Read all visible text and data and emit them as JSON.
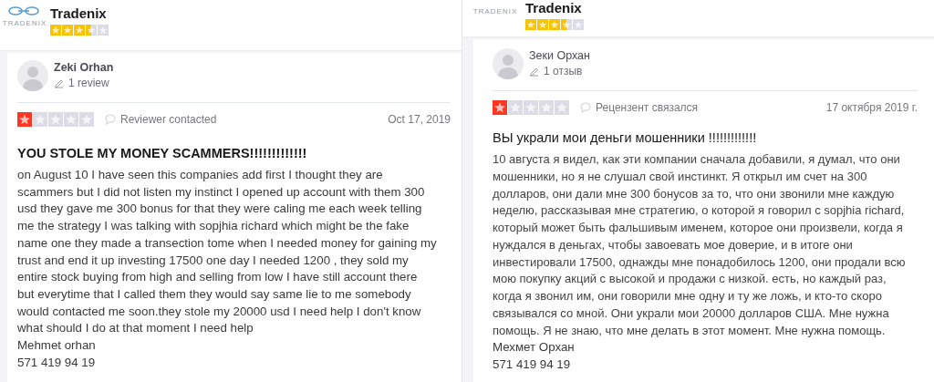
{
  "panels": [
    {
      "kind": "full",
      "company": {
        "logo_text": "TRADENIX",
        "name": "Tradenix",
        "stars": 3.5
      },
      "review": {
        "reviewer": "Zeki Orhan",
        "review_count": "1 review",
        "stars": 1,
        "status": "Reviewer contacted",
        "date": "Oct 17, 2019",
        "title": "YOU STOLE MY MONEY SCAMMERS!!!!!!!!!!!!!",
        "body": "on August 10 I have seen this companies add first I thought they are\nscammers but I did not listen my instinct I opened up account with them 300\nusd they gave me 300 bonus for that they were caling me each week telling\nme the strategy I was talking with sopjhia richard which might be the fake\nname one they made a transection tome when I needed money for gaining my\ntrust and end it up investing 17500 one day I needed 1200 , they sold my\nentire stock buying from high and selling from low I have still account there\nbut everytime that I called them they would say same lie to me somebody\nwould contacted me soon.they stole my 20000 usd I need help I don't know\nwhat should I do at that moment I need help",
        "signature": "Mehmet orhan",
        "phone": "571 419 94 19"
      }
    },
    {
      "kind": "scrolled",
      "company": {
        "logo_text": "TRADENIX",
        "name": "Tradenix",
        "stars": 3.5
      },
      "review": {
        "reviewer": "Зеки Орхан",
        "review_count": "1 отзыв",
        "stars": 1,
        "status": "Рецензент связался",
        "date": "17 октября 2019 г.",
        "title": "ВЫ украли мои деньги мошенники !!!!!!!!!!!!!",
        "body": "10 августа я видел, как эти компании сначала добавили, я думал, что они\nмошенники, но я не слушал свой инстинкт. Я открыл им счет на 300\nдолларов, они дали мне 300 бонусов за то, что они звонили мне каждую\nнеделю, рассказывая мне стратегию, о которой я говорил с sopjhia richard,\nкоторый может быть фальшивым именем, которое они произвели, когда я\nнуждался в деньгах, чтобы завоевать мое доверие, и в итоге они\nинвестировали 17500, однажды мне понадобилось 1200, они продали всю\nмою покупку акций с высокой и продажи с низкой. есть, но каждый раз,\nкогда я звонил им, они говорили мне одну и ту же ложь, и кто-то скоро\nсвязывался со мной. Они украли мои 20000 долларов США. Мне нужна\nпомощь. Я не знаю, что мне делать в этот момент. Мне нужна помощь.",
        "signature": "Мехмет Орхан",
        "phone": "571 419 94 19"
      }
    }
  ]
}
